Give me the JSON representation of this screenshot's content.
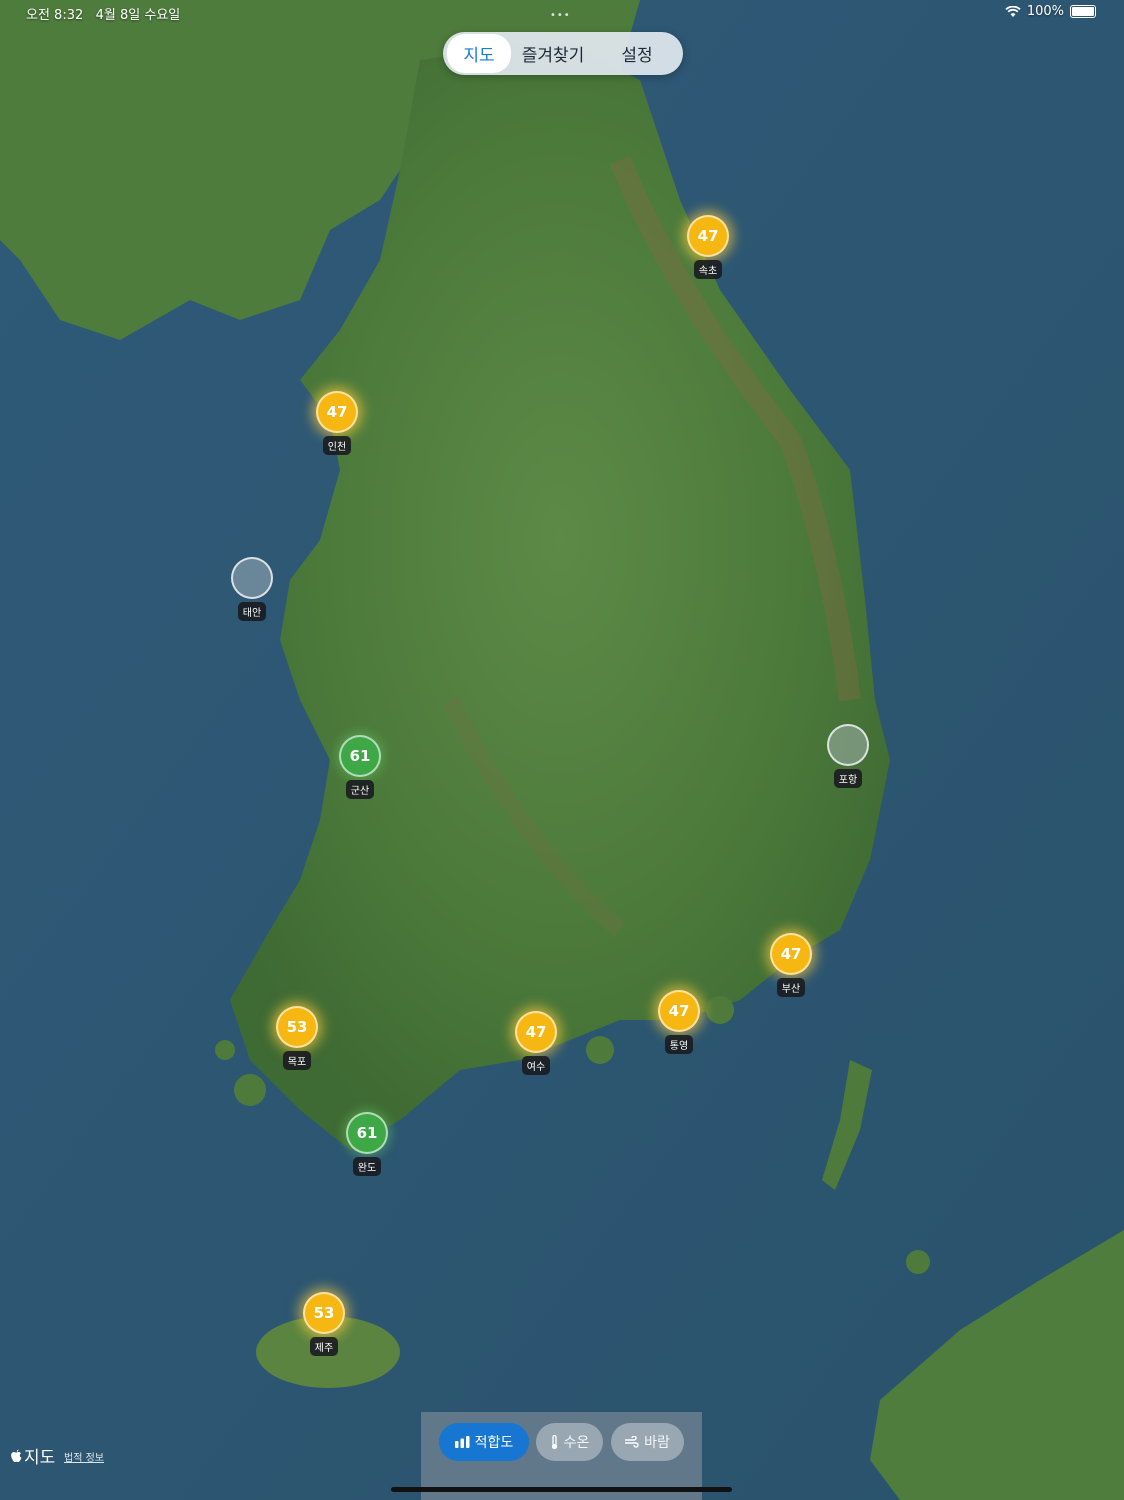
{
  "status_bar": {
    "time": "오전 8:32",
    "date": "4월 8일 수요일",
    "battery": "100%"
  },
  "top_segment": {
    "tabs": [
      "지도",
      "즐겨찾기",
      "설정"
    ],
    "active": "지도"
  },
  "markers": [
    {
      "name": "속초",
      "value": "47",
      "color": "yellow"
    },
    {
      "name": "인천",
      "value": "47",
      "color": "yellow"
    },
    {
      "name": "태안",
      "value": "",
      "color": "gray"
    },
    {
      "name": "포항",
      "value": "",
      "color": "gray"
    },
    {
      "name": "군산",
      "value": "61",
      "color": "green"
    },
    {
      "name": "부산",
      "value": "47",
      "color": "yellow"
    },
    {
      "name": "통영",
      "value": "47",
      "color": "yellow"
    },
    {
      "name": "여수",
      "value": "47",
      "color": "yellow"
    },
    {
      "name": "목포",
      "value": "53",
      "color": "yellow"
    },
    {
      "name": "완도",
      "value": "61",
      "color": "green"
    },
    {
      "name": "제주",
      "value": "53",
      "color": "yellow"
    }
  ],
  "bottom_bar": {
    "suitability": "적합도",
    "water_temp": "수온",
    "wind": "바람"
  },
  "attribution": {
    "logo_text": "지도",
    "legal": "법적 정보"
  },
  "colors": {
    "accent": "#1676d2",
    "marker_yellow": "#f7b713",
    "marker_green": "#3ea746",
    "sea": "#2c5672",
    "land": "#4a7a3a"
  }
}
